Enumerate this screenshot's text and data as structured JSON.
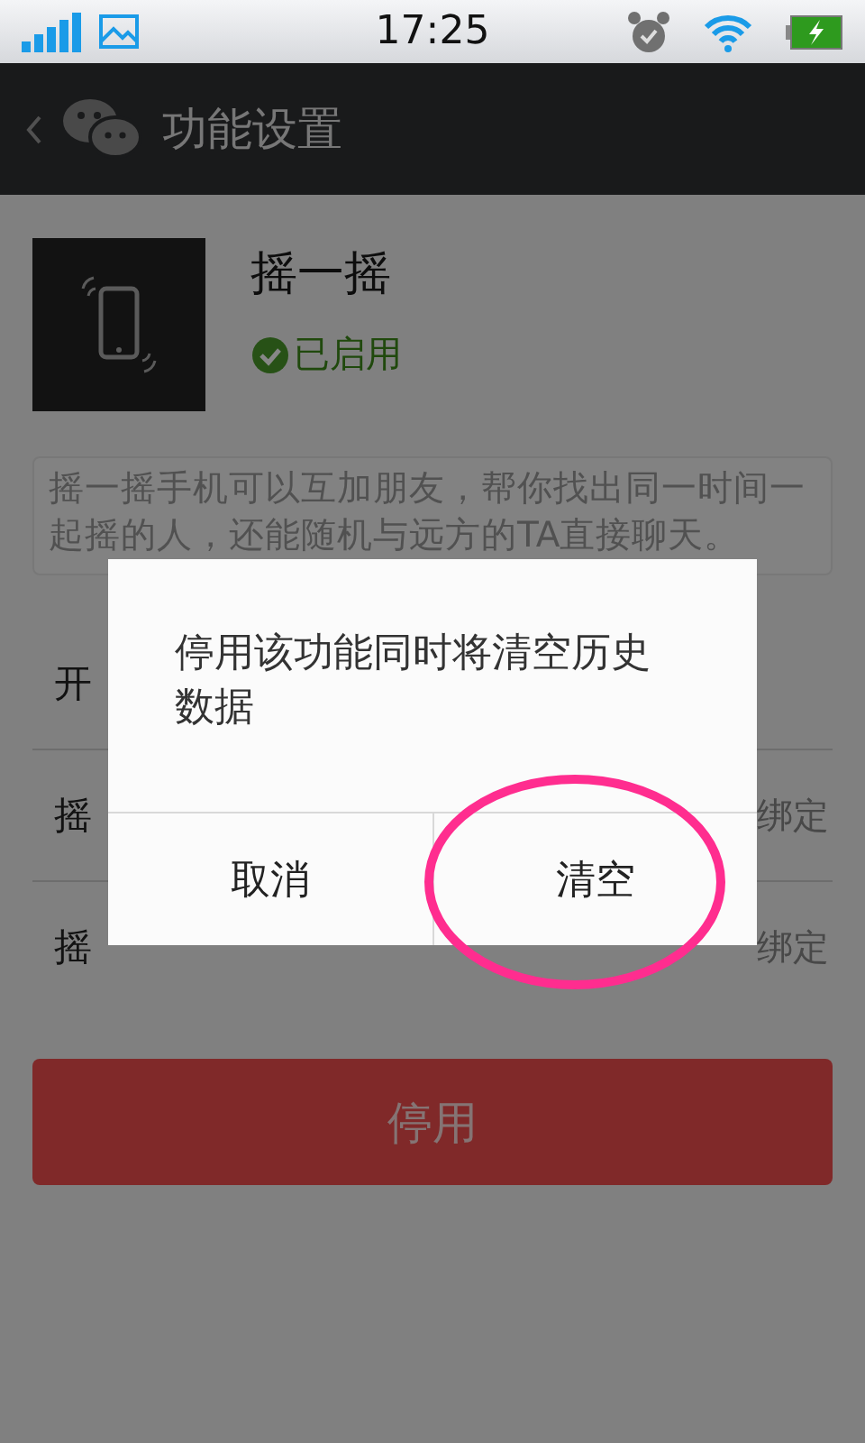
{
  "status_bar": {
    "time": "17:25"
  },
  "header": {
    "title": "功能设置"
  },
  "feature": {
    "name": "摇一摇",
    "status": "已启用",
    "enabled": true,
    "description": "摇一摇手机可以互加朋友，帮你找出同一时间一起摇的人，还能随机与远方的TA直接聊天。"
  },
  "rows": [
    {
      "label": "开"
    },
    {
      "label": "摇",
      "value": "绑定"
    },
    {
      "label": "摇",
      "value": "绑定"
    }
  ],
  "action_button": "停用",
  "dialog": {
    "message": "停用该功能同时将清空历史数据",
    "buttons": [
      {
        "label": "取消",
        "highlighted": false
      },
      {
        "label": "清空",
        "highlighted": true
      }
    ]
  }
}
